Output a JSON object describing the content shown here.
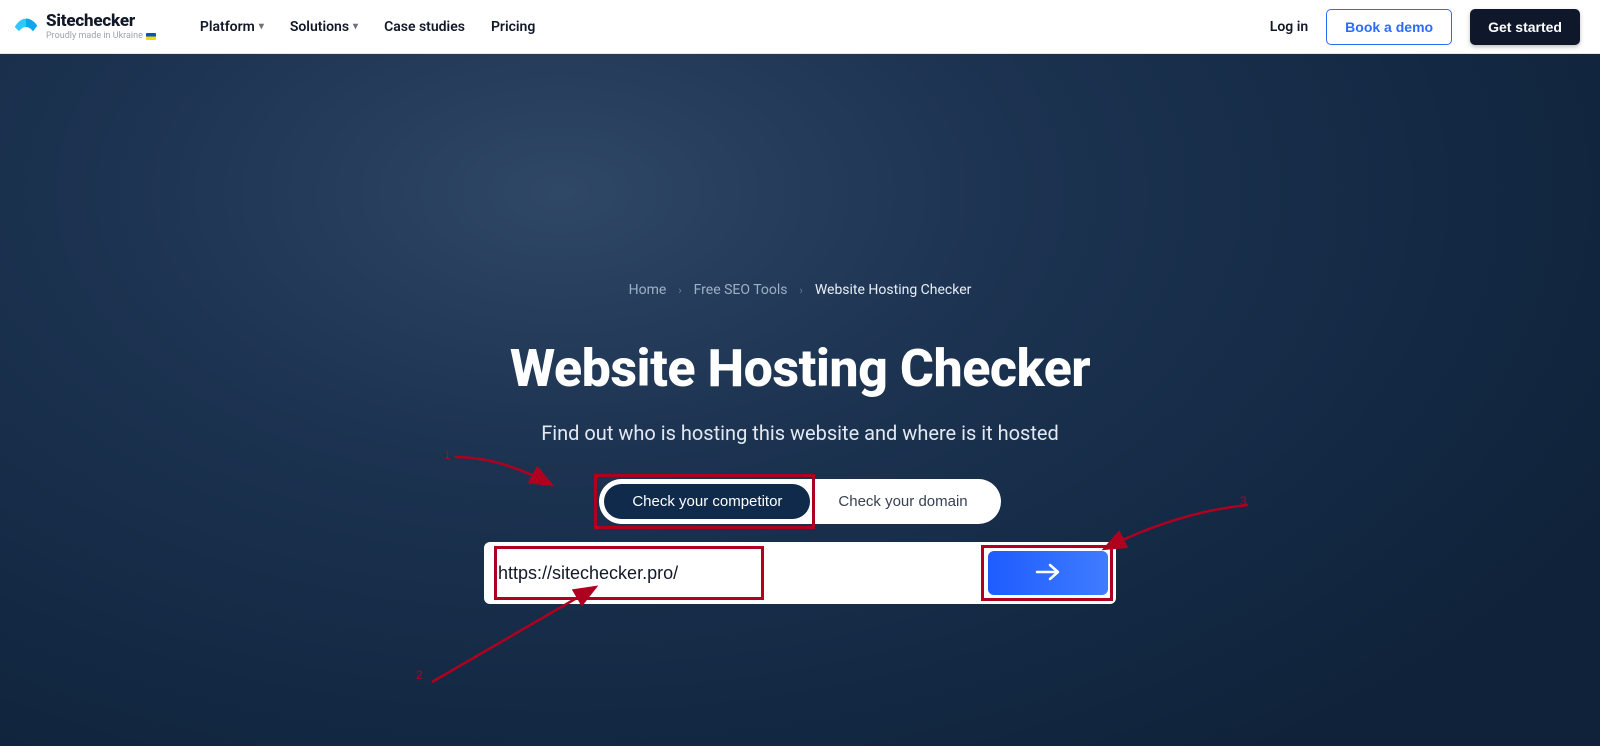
{
  "header": {
    "brand_name": "Sitechecker",
    "brand_sub": "Proudly made in Ukraine",
    "nav": {
      "platform": "Platform",
      "solutions": "Solutions",
      "case_studies": "Case studies",
      "pricing": "Pricing"
    },
    "right": {
      "login": "Log in",
      "book_demo": "Book a demo",
      "get_started": "Get started"
    }
  },
  "breadcrumb": {
    "home": "Home",
    "tools": "Free SEO Tools",
    "current": "Website Hosting Checker"
  },
  "hero": {
    "title": "Website Hosting Checker",
    "subtitle": "Find out who is hosting this website and where is it hosted"
  },
  "toggle": {
    "competitor": "Check your competitor",
    "domain": "Check your domain"
  },
  "form": {
    "url_value": "https://sitechecker.pro/"
  },
  "annotations": {
    "one": "1",
    "two": "2",
    "three": "3"
  },
  "colors": {
    "accent_blue": "#2b6cff",
    "hero_bg_dark": "#142a45",
    "annotation_red": "#b00020"
  }
}
